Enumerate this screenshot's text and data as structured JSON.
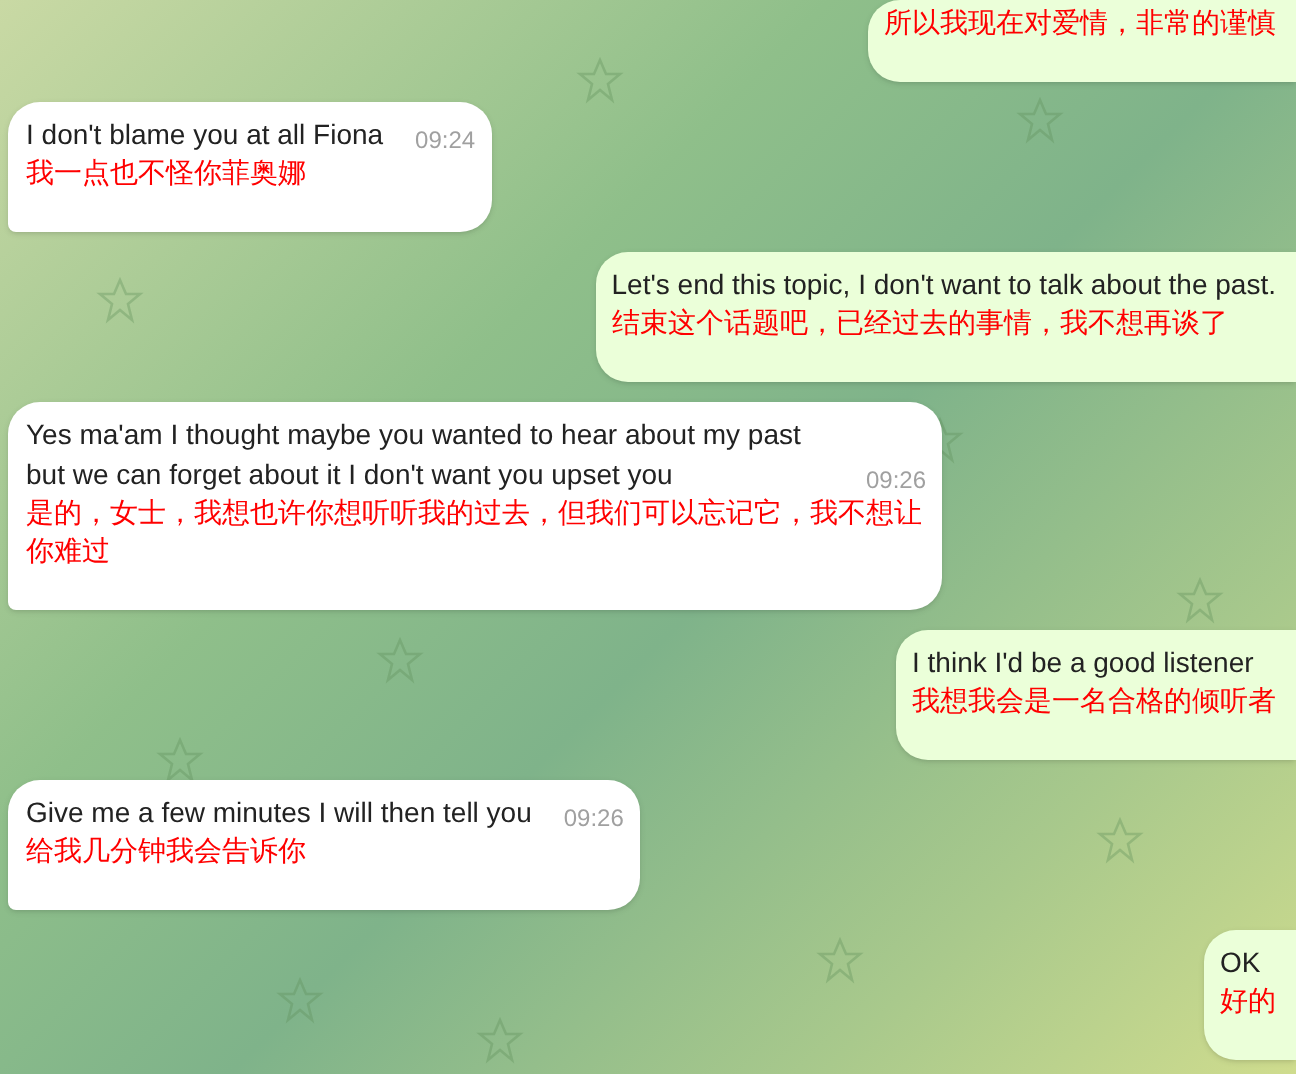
{
  "messages": [
    {
      "kind": "outgoing",
      "translation": "所以我现在对爱情，非常的谨慎"
    },
    {
      "kind": "incoming",
      "text": "I don't blame you at all Fiona",
      "translation": "我一点也不怪你菲奥娜",
      "time": "09:24"
    },
    {
      "kind": "outgoing",
      "text": "Let's end this topic, I don't want to talk about the past.",
      "translation": "结束这个话题吧，已经过去的事情，我不想再谈了"
    },
    {
      "kind": "incoming",
      "text": "Yes ma'am I thought maybe you wanted to hear about my past but we can forget about it I don't want you upset you",
      "translation": "是的，女士，我想也许你想听听我的过去，但我们可以忘记它，我不想让你难过",
      "time": "09:26"
    },
    {
      "kind": "outgoing",
      "text": "I think I'd be a good listener",
      "translation": "我想我会是一名合格的倾听者"
    },
    {
      "kind": "incoming",
      "text": "Give me a few minutes I will then tell you",
      "translation": "给我几分钟我会告诉你",
      "time": "09:26"
    },
    {
      "kind": "outgoing",
      "text": "OK",
      "translation": "好的"
    }
  ]
}
